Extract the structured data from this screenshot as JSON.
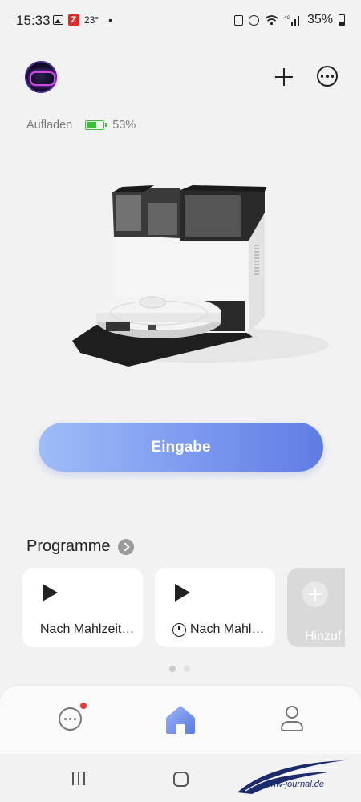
{
  "status_bar": {
    "time": "15:33",
    "temperature": "23°",
    "network": "4G",
    "battery_percent": "35%",
    "icons": [
      "image-icon",
      "z-app-icon",
      "dot-icon",
      "sim-icon",
      "alarm-icon",
      "wifi-icon",
      "signal-icon",
      "battery-icon"
    ]
  },
  "header": {
    "device_avatar": "robot-avatar",
    "add_icon": "plus-icon",
    "more_icon": "more-options-icon"
  },
  "device_status": {
    "state": "Aufladen",
    "battery_level": 0.53,
    "battery_text": "53%",
    "battery_color": "#3bbf3b"
  },
  "primary_action": {
    "label": "Eingabe",
    "gradient_start": "#9fbcf7",
    "gradient_end": "#5f7ce4"
  },
  "programs": {
    "title": "Programme",
    "items": [
      {
        "label": "Nach Mahlzeit…",
        "icon": "play-icon"
      },
      {
        "label": "Nach Mahl…",
        "icon": "play-icon",
        "label_icon": "clock-icon"
      }
    ],
    "add_label": "Hinzuf",
    "page_index": 1,
    "page_count": 2
  },
  "bottom_nav": {
    "items": [
      "chat-icon",
      "home-icon",
      "profile-icon"
    ],
    "active": "home-icon",
    "accent": "#6a8ae8",
    "badge_color": "#e53935"
  },
  "watermark": {
    "text": "hw-journal.de"
  }
}
